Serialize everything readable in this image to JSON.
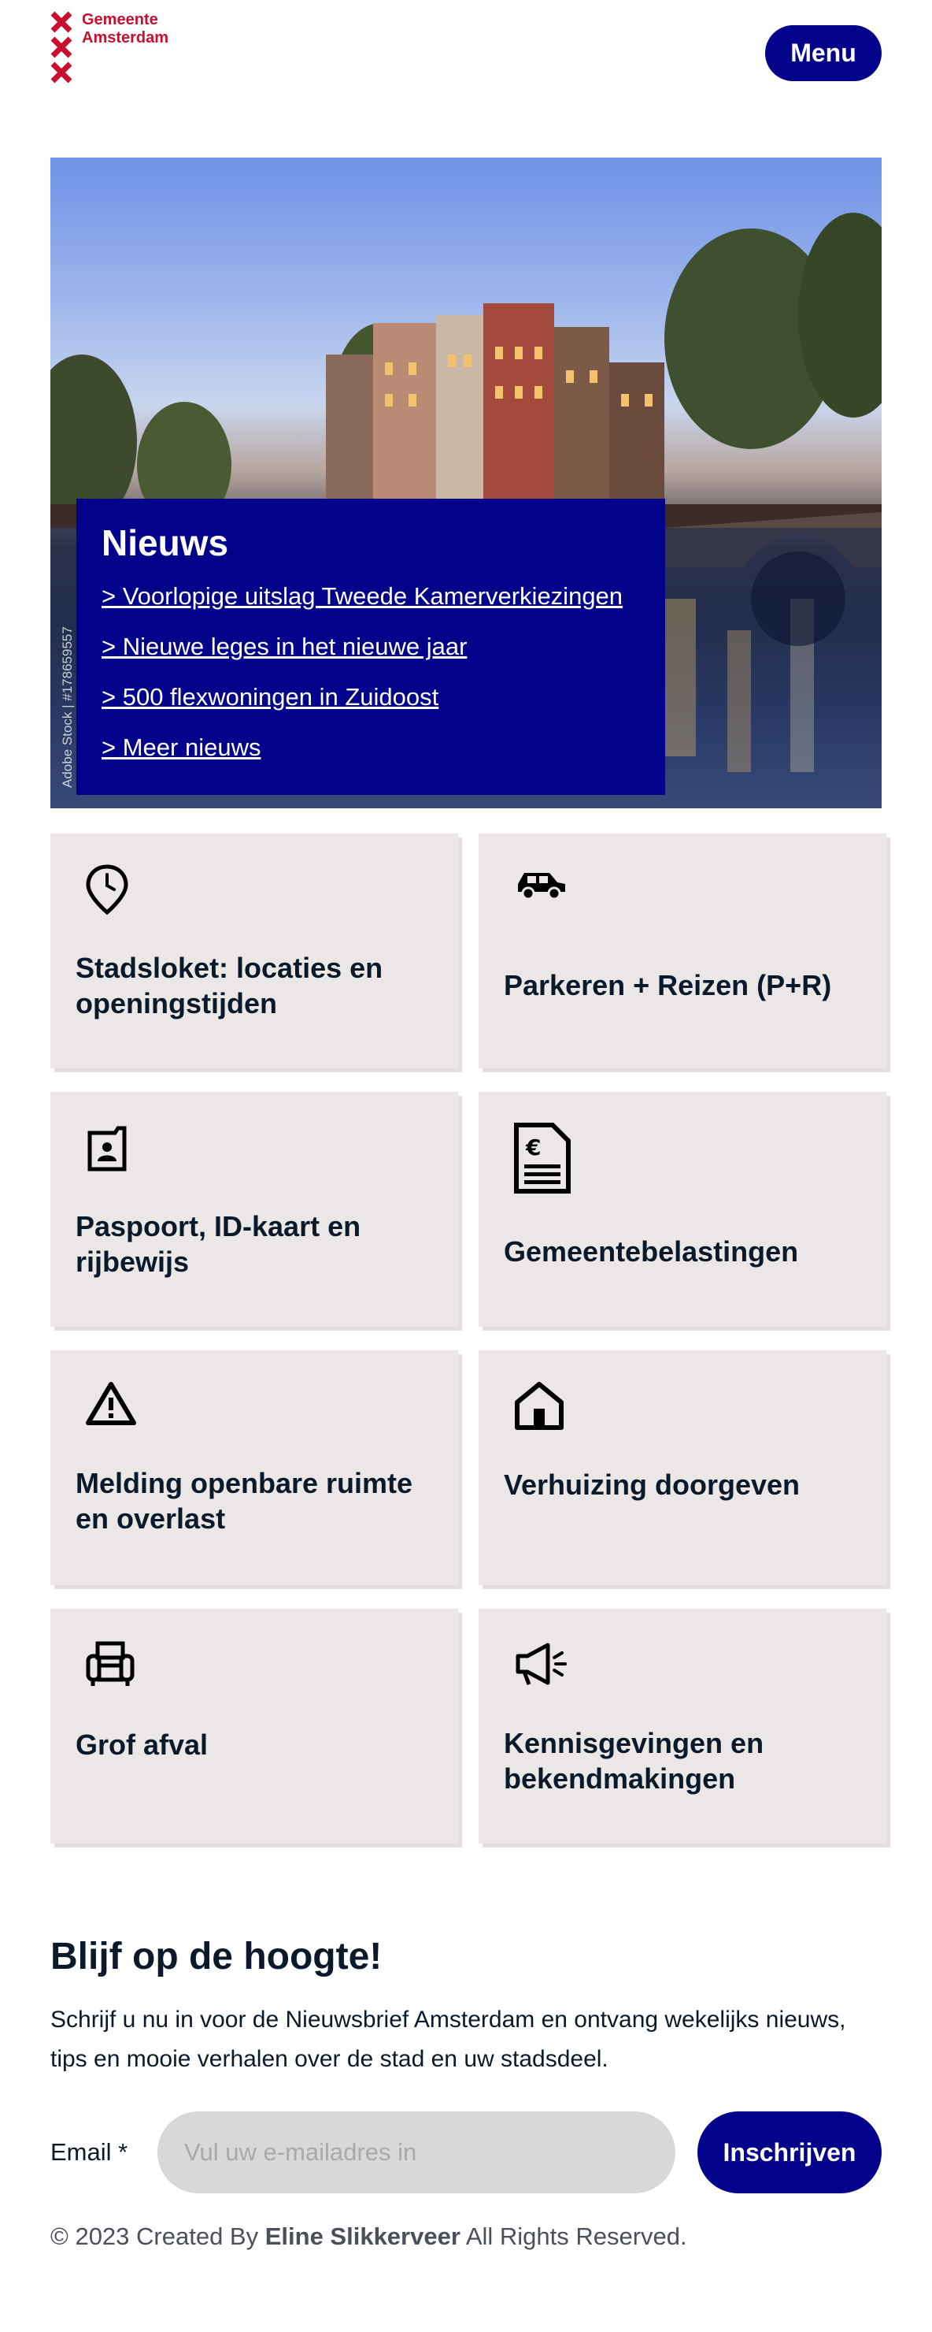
{
  "header": {
    "logo_line1": "Gemeente",
    "logo_line2": "Amsterdam",
    "menu_label": "Menu",
    "brand_color": "#c8102e",
    "accent_color": "#02028a"
  },
  "hero": {
    "stock_label": "Adobe Stock | #178659557",
    "news_title": "Nieuws",
    "news_links": [
      "> Voorlopige uitslag Tweede Kamerverkiezingen",
      "> Nieuwe leges in het nieuwe jaar",
      "> 500 flexwoningen in Zuidoost",
      "> Meer nieuws"
    ]
  },
  "tiles": [
    {
      "label": "Stadsloket: locaties en openingstijden",
      "icon": "location-clock-icon"
    },
    {
      "label": "Parkeren + Reizen (P+R)",
      "icon": "car-icon"
    },
    {
      "label": "Paspoort, ID-kaart en rijbewijs",
      "icon": "id-card-icon"
    },
    {
      "label": "Gemeentebelastingen",
      "icon": "tax-document-icon"
    },
    {
      "label": "Melding openbare ruimte en overlast",
      "icon": "warning-icon"
    },
    {
      "label": "Verhuizing doorgeven",
      "icon": "house-icon"
    },
    {
      "label": "Grof afval",
      "icon": "armchair-icon"
    },
    {
      "label": "Kennisgevingen en bekendmakingen",
      "icon": "megaphone-icon"
    }
  ],
  "newsletter": {
    "title": "Blijf op de hoogte!",
    "text": "Schrijf u nu in voor de Nieuwsbrief Amsterdam en ontvang wekelijks nieuws, tips en mooie verhalen over de stad en uw stadsdeel.",
    "email_label": "Email *",
    "email_placeholder": "Vul uw e-mailadres in",
    "submit_label": "Inschrijven"
  },
  "footer": {
    "prefix": "© 2023 Created By",
    "author": "Eline Slikkerveer",
    "suffix": "All Rights Reserved."
  }
}
